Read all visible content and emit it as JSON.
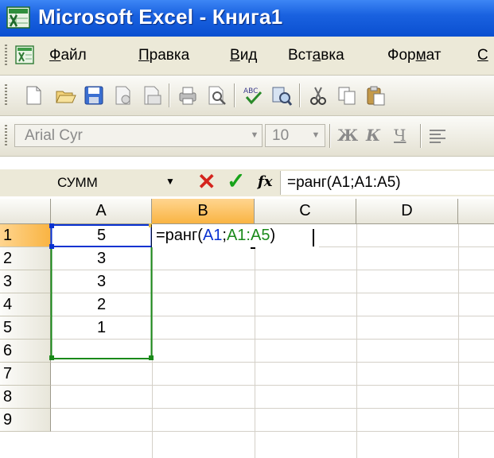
{
  "window": {
    "title": "Microsoft Excel - Книга1"
  },
  "menu": {
    "items": [
      {
        "pre": "",
        "ul": "Ф",
        "post": "айл"
      },
      {
        "pre": "",
        "ul": "П",
        "post": "равка"
      },
      {
        "pre": "",
        "ul": "В",
        "post": "ид"
      },
      {
        "pre": "Вст",
        "ul": "а",
        "post": "вка"
      },
      {
        "pre": "Фор",
        "ul": "м",
        "post": "ат"
      },
      {
        "pre": "",
        "ul": "С",
        "post": ""
      }
    ]
  },
  "format_toolbar": {
    "font": "Arial Cyr",
    "size": "10",
    "bold": "Ж",
    "italic": "К",
    "underline": "Ч"
  },
  "formula_bar": {
    "name_box": "СУММ",
    "fx": "fx",
    "formula": "=ранг(A1;A1:A5)"
  },
  "grid": {
    "columns": [
      "A",
      "B",
      "C",
      "D"
    ],
    "rows": [
      "1",
      "2",
      "3",
      "4",
      "5",
      "6",
      "7",
      "8",
      "9"
    ],
    "values_a": [
      "5",
      "3",
      "3",
      "2",
      "1"
    ],
    "edit": {
      "prefix": "=ранг(",
      "ref1": "A1",
      "sep": ";",
      "ref2": "A1:A5",
      "suffix": ")"
    }
  },
  "colors": {
    "title_bar": "#1a62e0",
    "ref1_border": "#0a32d1",
    "ref2_border": "#1a8a1a",
    "cancel": "#d4231c",
    "enter": "#18a31a"
  }
}
